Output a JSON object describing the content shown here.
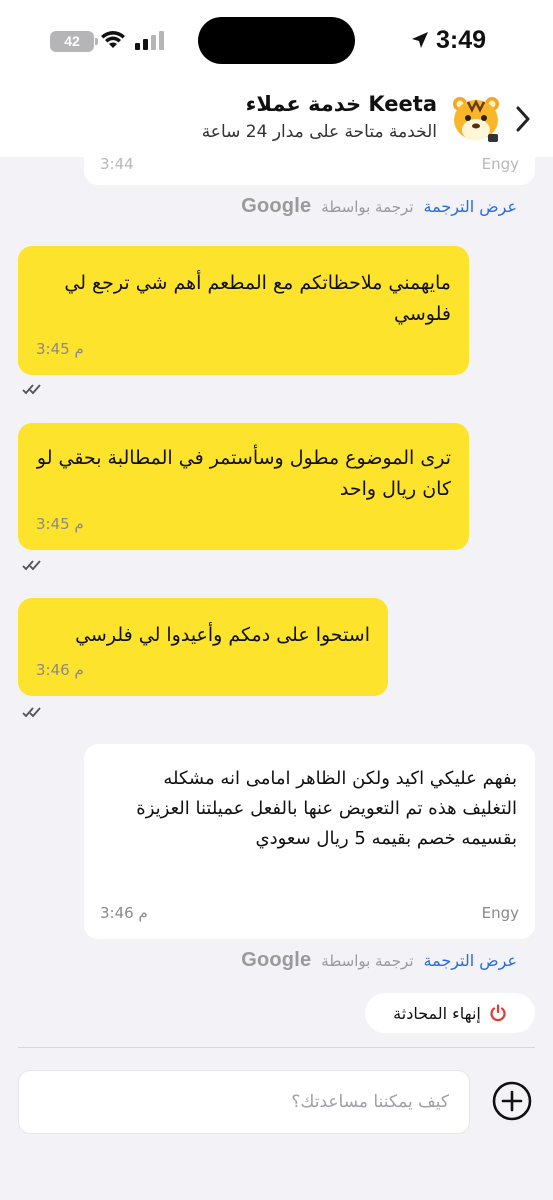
{
  "status_bar": {
    "time": "3:49",
    "battery": "42"
  },
  "header": {
    "title": "خدمة عملاء Keeta",
    "subtitle": "الخدمة متاحة على مدار 24 ساعة"
  },
  "partial_message": {
    "time": "3:44",
    "sender": "Engy"
  },
  "translation": {
    "show_label": "عرض الترجمة",
    "by_label": "ترجمة بواسطة",
    "provider": "Google"
  },
  "messages": [
    {
      "text": "مايهمني ملاحظاتكم مع المطعم أهم شي ترجع لي فلوسي",
      "time": "3:45 م"
    },
    {
      "text": "ترى الموضوع مطول وسأستمر في المطالبة بحقي لو كان ريال واحد",
      "time": "3:45 م"
    },
    {
      "text": "استحوا على دمكم وأعيدوا لي فلرسي",
      "time": "3:46 م"
    },
    {
      "text": "بفهم عليكي اكيد ولكن الظاهر امامى انه مشكله التغليف هذه تم التعويض عنها بالفعل عميلتنا العزيزة بقسيمه خصم بقيمه 5 ريال سعودي",
      "time": "3:46 م",
      "sender": "Engy"
    }
  ],
  "end_chat_label": "إنهاء المحادثة",
  "composer": {
    "placeholder": "كيف يمكننا مساعدتك؟"
  },
  "colors": {
    "user_bubble": "#fde32b",
    "agent_bubble": "#ffffff",
    "link": "#2a6dd9",
    "end_icon": "#e53935"
  }
}
